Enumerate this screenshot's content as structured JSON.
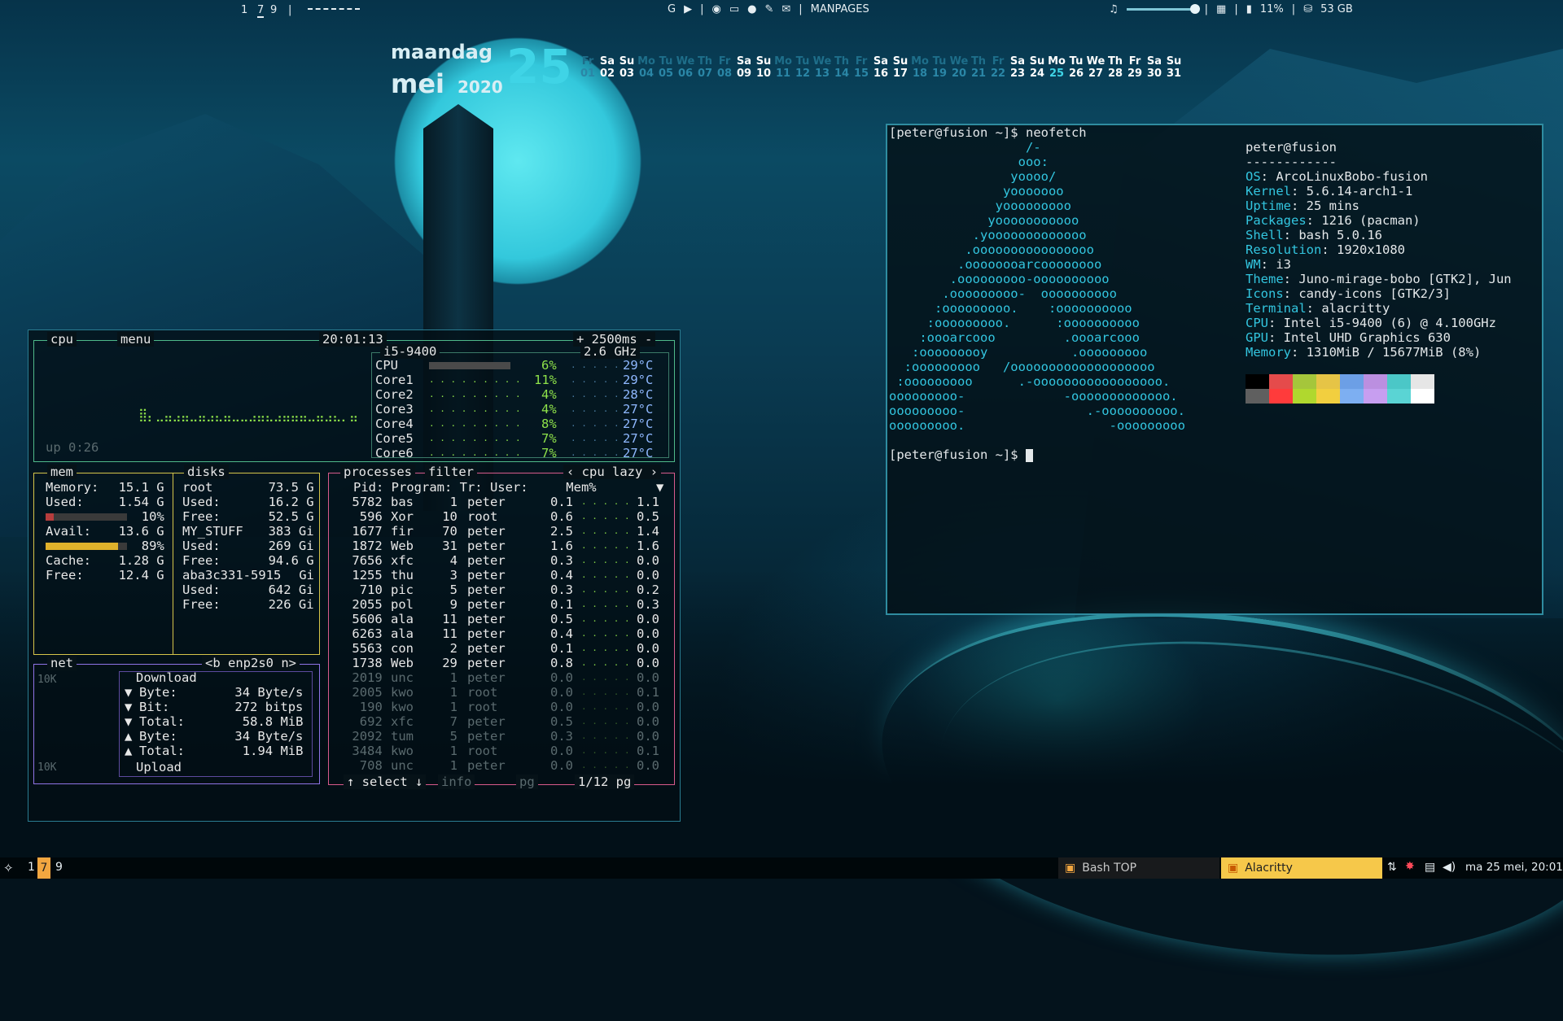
{
  "topbar": {
    "workspaces": [
      "1",
      "7",
      "9"
    ],
    "separator": "|",
    "center_label": "MANPAGES",
    "battery": "11%",
    "disk": "53 GB",
    "icons": [
      "google-icon",
      "youtube-icon",
      "firefox-icon",
      "folder-icon",
      "github-icon",
      "feather-icon",
      "chat-icon"
    ]
  },
  "calendar": {
    "weekday": "maandag",
    "month": "mei",
    "year": "2020",
    "day": "25",
    "days": [
      {
        "d": "Fr",
        "n": "01"
      },
      {
        "d": "Sa",
        "n": "02"
      },
      {
        "d": "Su",
        "n": "03"
      },
      {
        "d": "Mo",
        "n": "04"
      },
      {
        "d": "Tu",
        "n": "05"
      },
      {
        "d": "We",
        "n": "06"
      },
      {
        "d": "Th",
        "n": "07"
      },
      {
        "d": "Fr",
        "n": "08"
      },
      {
        "d": "Sa",
        "n": "09"
      },
      {
        "d": "Su",
        "n": "10"
      },
      {
        "d": "Mo",
        "n": "11"
      },
      {
        "d": "Tu",
        "n": "12"
      },
      {
        "d": "We",
        "n": "13"
      },
      {
        "d": "Th",
        "n": "14"
      },
      {
        "d": "Fr",
        "n": "15"
      },
      {
        "d": "Sa",
        "n": "16"
      },
      {
        "d": "Su",
        "n": "17"
      },
      {
        "d": "Mo",
        "n": "18"
      },
      {
        "d": "Tu",
        "n": "19"
      },
      {
        "d": "We",
        "n": "20"
      },
      {
        "d": "Th",
        "n": "21"
      },
      {
        "d": "Fr",
        "n": "22"
      },
      {
        "d": "Sa",
        "n": "23"
      },
      {
        "d": "Su",
        "n": "24"
      },
      {
        "d": "Mo",
        "n": "25"
      },
      {
        "d": "Tu",
        "n": "26"
      },
      {
        "d": "We",
        "n": "27"
      },
      {
        "d": "Th",
        "n": "28"
      },
      {
        "d": "Fr",
        "n": "29"
      },
      {
        "d": "Sa",
        "n": "30"
      },
      {
        "d": "Su",
        "n": "31"
      }
    ]
  },
  "btop": {
    "cpu": {
      "title": "cpu",
      "menu": "menu",
      "clock": "20:01:13",
      "interval": "+ 2500ms -",
      "model": "i5-9400",
      "freq": "2.6 GHz",
      "uptime": "up 0:26",
      "cores": [
        {
          "name": "CPU",
          "pct": "6%",
          "temp": "29°C"
        },
        {
          "name": "Core1",
          "pct": "11%",
          "temp": "29°C"
        },
        {
          "name": "Core2",
          "pct": "4%",
          "temp": "28°C"
        },
        {
          "name": "Core3",
          "pct": "4%",
          "temp": "27°C"
        },
        {
          "name": "Core4",
          "pct": "8%",
          "temp": "27°C"
        },
        {
          "name": "Core5",
          "pct": "7%",
          "temp": "27°C"
        },
        {
          "name": "Core6",
          "pct": "7%",
          "temp": "27°C"
        }
      ]
    },
    "mem": {
      "title": "mem",
      "lines": [
        {
          "label": "Memory:",
          "value": "15.1 G"
        },
        {
          "label": "Used:",
          "value": "1.54 G"
        },
        {
          "label": "",
          "value": "10%"
        },
        {
          "label": "Avail:",
          "value": "13.6 G"
        },
        {
          "label": "",
          "value": "89%"
        },
        {
          "label": "Cache:",
          "value": "1.28 G"
        },
        {
          "label": "Free:",
          "value": "12.4 G"
        }
      ],
      "used_fraction": 0.1,
      "avail_fraction": 0.89
    },
    "disks": {
      "title": "disks",
      "lines": [
        {
          "label": "root",
          "value": "73.5 G"
        },
        {
          "label": "Used:",
          "value": "16.2 G"
        },
        {
          "label": "Free:",
          "value": "52.5 G"
        },
        {
          "label": "MY_STUFF",
          "value": "383 Gi"
        },
        {
          "label": "Used:",
          "value": "269 Gi"
        },
        {
          "label": "Free:",
          "value": "94.6 G"
        },
        {
          "label": "aba3c331-5915",
          "value": "Gi"
        },
        {
          "label": "Used:",
          "value": "642 Gi"
        },
        {
          "label": "Free:",
          "value": "226 Gi"
        }
      ]
    },
    "net": {
      "title": "net",
      "iface": "enp2s0",
      "scale_top": "10K",
      "scale_bottom": "10K",
      "download": "Download",
      "upload": "Upload",
      "lines": [
        {
          "arrow": "▼",
          "label": "Byte:",
          "value": "34 Byte/s"
        },
        {
          "arrow": "▼",
          "label": "Bit:",
          "value": "272 bitps"
        },
        {
          "arrow": "▼",
          "label": "Total:",
          "value": "58.8 MiB"
        },
        {
          "arrow": "▲",
          "label": "Byte:",
          "value": "34 Byte/s"
        },
        {
          "arrow": "▲",
          "label": "Total:",
          "value": "1.94 MiB"
        }
      ]
    },
    "proc": {
      "title": "processes",
      "filter": "filter",
      "sort": "cpu lazy",
      "header": "Pid: Program: Tr: User:     Mem%",
      "rows": [
        [
          "5782",
          "bas",
          "1",
          "peter",
          "0.1",
          "1.1"
        ],
        [
          "596",
          "Xor",
          "10",
          "root",
          "0.6",
          "0.5"
        ],
        [
          "1677",
          "fir",
          "70",
          "peter",
          "2.5",
          "1.4"
        ],
        [
          "1872",
          "Web",
          "31",
          "peter",
          "1.6",
          "1.6"
        ],
        [
          "7656",
          "xfc",
          "4",
          "peter",
          "0.3",
          "0.0"
        ],
        [
          "1255",
          "thu",
          "3",
          "peter",
          "0.4",
          "0.0"
        ],
        [
          "710",
          "pic",
          "5",
          "peter",
          "0.3",
          "0.2"
        ],
        [
          "2055",
          "pol",
          "9",
          "peter",
          "0.1",
          "0.3"
        ],
        [
          "5606",
          "ala",
          "11",
          "peter",
          "0.5",
          "0.0"
        ],
        [
          "6263",
          "ala",
          "11",
          "peter",
          "0.4",
          "0.0"
        ],
        [
          "5563",
          "con",
          "2",
          "peter",
          "0.1",
          "0.0"
        ],
        [
          "1738",
          "Web",
          "29",
          "peter",
          "0.8",
          "0.0"
        ],
        [
          "2019",
          "unc",
          "1",
          "peter",
          "0.0",
          "0.0"
        ],
        [
          "2005",
          "kwo",
          "1",
          "root",
          "0.0",
          "0.1"
        ],
        [
          "190",
          "kwo",
          "1",
          "root",
          "0.0",
          "0.0"
        ],
        [
          "692",
          "xfc",
          "7",
          "peter",
          "0.5",
          "0.0"
        ],
        [
          "2092",
          "tum",
          "5",
          "peter",
          "0.3",
          "0.0"
        ],
        [
          "3484",
          "kwo",
          "1",
          "root",
          "0.0",
          "0.1"
        ],
        [
          "708",
          "unc",
          "1",
          "peter",
          "0.0",
          "0.0"
        ]
      ],
      "select": "select",
      "info": "info",
      "pg": "pg",
      "page": "1/12 pg"
    }
  },
  "terminal": {
    "prompt": "[peter@fusion ~]$",
    "command": "neofetch",
    "ascii": [
      "                  /-",
      "                 ooo:",
      "                yoooo/",
      "               yooooooo",
      "              yooooooooo",
      "             yooooooooooo",
      "           .yooooooooooooo",
      "          .oooooooooooooooo",
      "         .oooooooarcoooooooo",
      "        .ooooooooo-oooooooooo",
      "       .ooooooooo-  oooooooooo",
      "      :ooooooooo.    :oooooooooo",
      "     :ooooooooo.      :oooooooooo",
      "    :oooarcooo         .oooarcooo",
      "   :ooooooooy           .ooooooooo",
      "  :ooooooooo   /ooooooooooooooooooo",
      " :ooooooooo      .-ooooooooooooooooo.",
      "ooooooooo-             -ooooooooooooo.",
      "ooooooooo-                .-oooooooooo.",
      "ooooooooo.                   -ooooooooo"
    ],
    "user_host": "peter@fusion",
    "rule": "------------",
    "info": [
      {
        "key": "OS",
        "value": "ArcoLinuxBobo-fusion"
      },
      {
        "key": "Kernel",
        "value": "5.6.14-arch1-1"
      },
      {
        "key": "Uptime",
        "value": "25 mins"
      },
      {
        "key": "Packages",
        "value": "1216 (pacman)"
      },
      {
        "key": "Shell",
        "value": "bash 5.0.16"
      },
      {
        "key": "Resolution",
        "value": "1920x1080"
      },
      {
        "key": "WM",
        "value": "i3"
      },
      {
        "key": "Theme",
        "value": "Juno-mirage-bobo [GTK2], Jun"
      },
      {
        "key": "Icons",
        "value": "candy-icons [GTK2/3]"
      },
      {
        "key": "Terminal",
        "value": "alacritty"
      },
      {
        "key": "CPU",
        "value": "Intel i5-9400 (6) @ 4.100GHz"
      },
      {
        "key": "GPU",
        "value": "Intel UHD Graphics 630"
      },
      {
        "key": "Memory",
        "value": "1310MiB / 15677MiB (8%)"
      }
    ],
    "colors_top": [
      "#000000",
      "#e54b4b",
      "#a5c63b",
      "#e6c446",
      "#6c9fe6",
      "#bb8fe0",
      "#4bc7c7",
      "#e6e6e6"
    ],
    "colors_bottom": [
      "#5f5f5f",
      "#ff3b3b",
      "#b0d82e",
      "#f2cf3f",
      "#7daff2",
      "#c79ef0",
      "#5ad4d4",
      "#ffffff"
    ]
  },
  "bottombar": {
    "workspaces": [
      "1",
      "7",
      "9"
    ],
    "active_workspace": "7",
    "tasks": [
      {
        "label": "Bash TOP"
      },
      {
        "label": "Alacritty"
      }
    ],
    "clock": "ma 25 mei, 20:01"
  }
}
